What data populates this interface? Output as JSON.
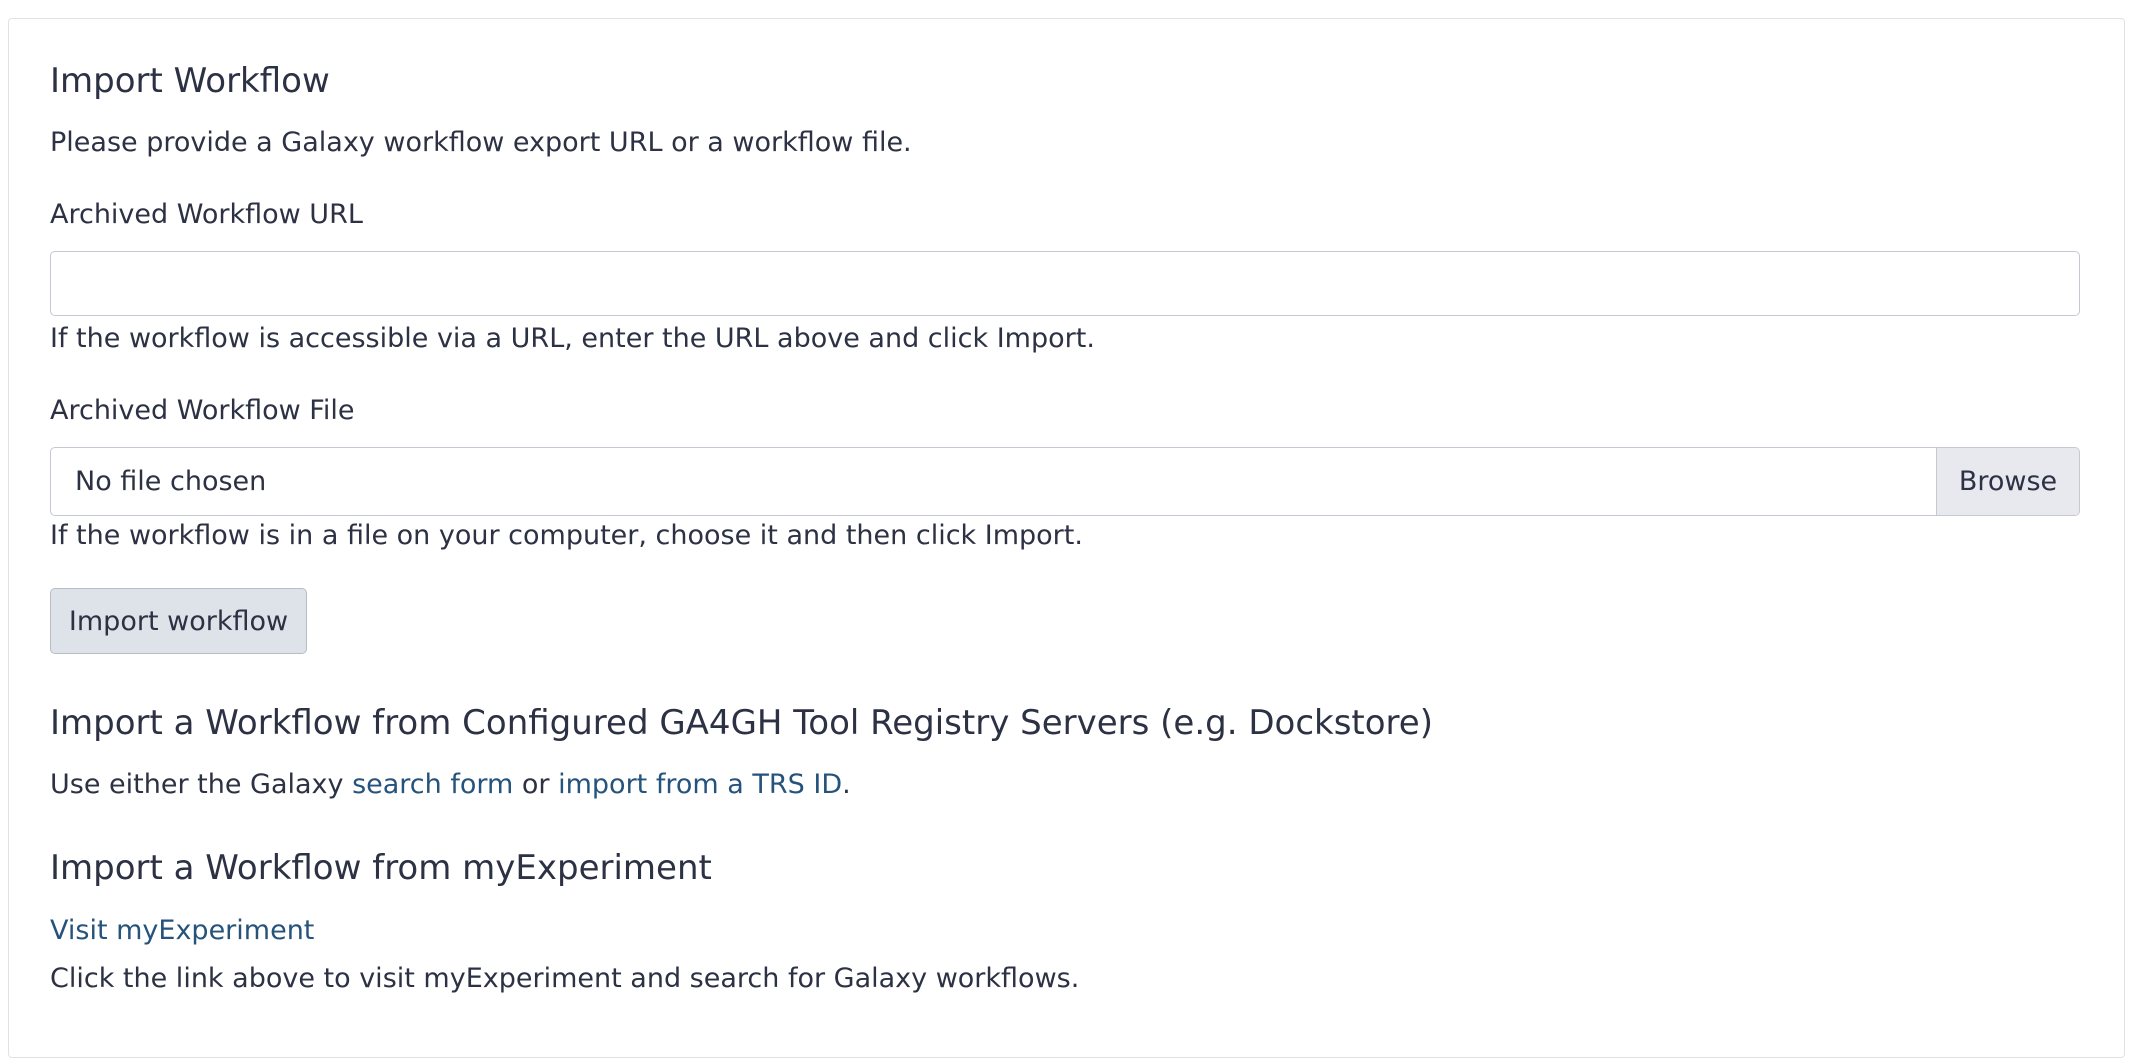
{
  "import_section": {
    "title": "Import Workflow",
    "description": "Please provide a Galaxy workflow export URL or a workflow file.",
    "url_field": {
      "label": "Archived Workflow URL",
      "value": "",
      "placeholder": "",
      "help": "If the workflow is accessible via a URL, enter the URL above and click Import."
    },
    "file_field": {
      "label": "Archived Workflow File",
      "file_name": "No file chosen",
      "browse_label": "Browse",
      "help": "If the workflow is in a file on your computer, choose it and then click Import."
    },
    "import_button_label": "Import workflow"
  },
  "trs_section": {
    "title": "Import a Workflow from Configured GA4GH Tool Registry Servers (e.g. Dockstore)",
    "text_before": "Use either the Galaxy ",
    "search_link": "search form",
    "text_middle": " or ",
    "trs_id_link": "import from a TRS ID",
    "text_after": "."
  },
  "myexperiment_section": {
    "title": "Import a Workflow from myExperiment",
    "link": "Visit myExperiment",
    "help": "Click the link above to visit myExperiment and search for Galaxy workflows."
  },
  "colors": {
    "text": "#2c3143",
    "link": "#25537b",
    "button_bg": "#dee2e9",
    "border": "#c6c9d2"
  }
}
